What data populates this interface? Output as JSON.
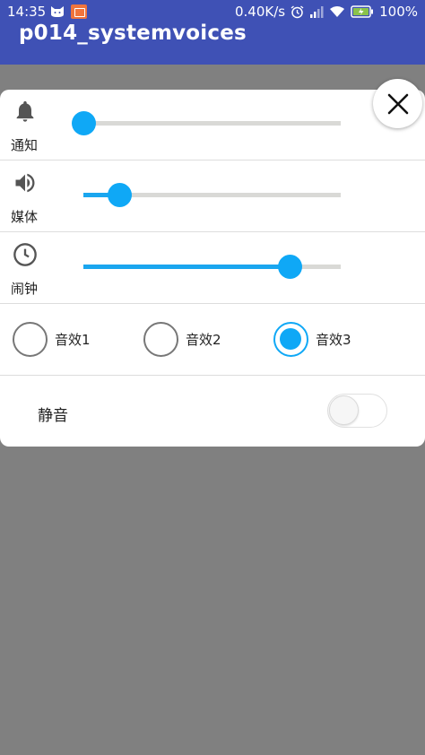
{
  "status_bar": {
    "time": "14:35",
    "network_speed": "0.40K/s",
    "battery": "100%"
  },
  "app": {
    "title": "p014_systemvoices"
  },
  "volume_rows": [
    {
      "label": "通知",
      "icon": "bell-icon",
      "level": 0.0
    },
    {
      "label": "媒体",
      "icon": "speaker-icon",
      "level": 0.14
    },
    {
      "label": "闹钟",
      "icon": "clock-icon",
      "level": 0.8
    }
  ],
  "sound_effects": {
    "options": [
      "音效1",
      "音效2",
      "音效3"
    ],
    "selected": "音效3"
  },
  "mute": {
    "label": "静音",
    "on": false
  },
  "colors": {
    "app_bar": "#3F51B5",
    "accent": "#0FA8F6",
    "scrim": "#808080"
  }
}
